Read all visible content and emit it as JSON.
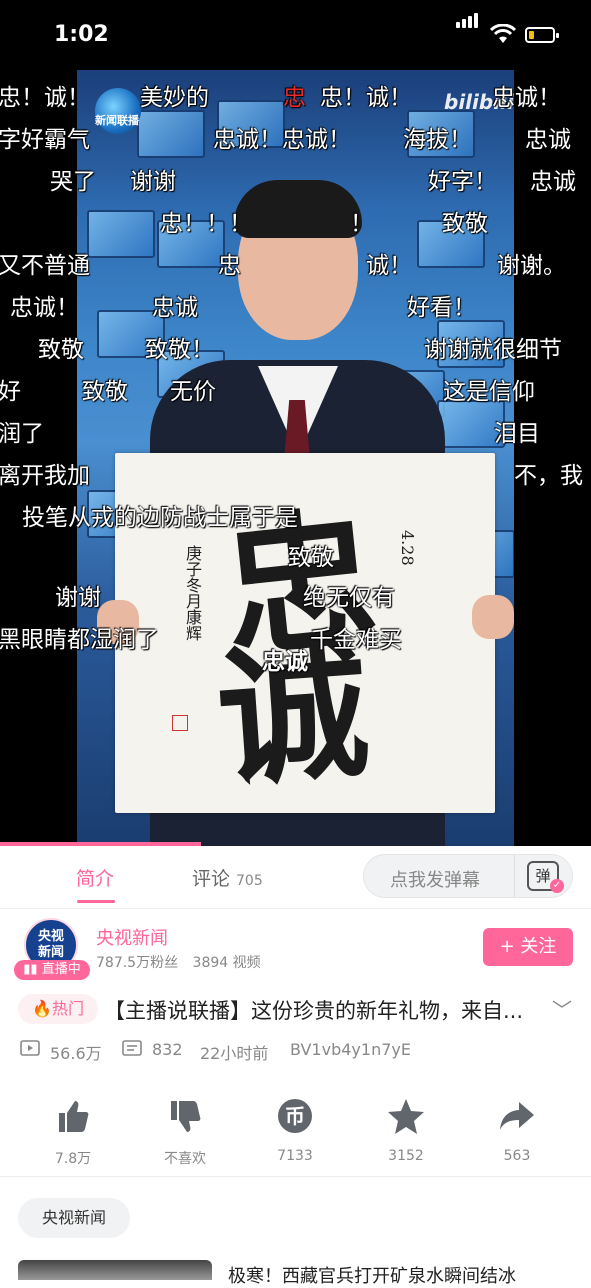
{
  "status_bar": {
    "time": "1:02"
  },
  "video": {
    "channel_logo_text": "新闻联播",
    "watermark": "bilibili",
    "calligraphy": {
      "char1": "忠",
      "char2": "诚",
      "left_inscription": "庚子冬月康辉",
      "right_inscription": "4.28"
    },
    "danmaku": [
      "忠！诚！",
      "美妙的",
      "忠",
      "忠！诚！",
      "忠诚！",
      "字好霸气",
      "忠诚！忠诚！",
      "海拔！",
      "忠诚",
      "哭了",
      "谢谢",
      "好字！",
      "忠诚",
      "忠！！！",
      "！",
      "致敬",
      "又不普通",
      "忠",
      "诚！",
      "谢谢。",
      "忠诚！",
      "忠诚",
      "好看！",
      "致敬",
      "致敬！",
      "谢谢就很细节",
      "好",
      "致敬",
      "无价",
      "这是信仰",
      "润了",
      "泪目",
      "离开我加",
      "不，我",
      "投笔从戎的边防战士属于是",
      "致敬",
      "谢谢",
      "绝无仅有",
      "黑眼睛都湿润了",
      "千金难买",
      "忠诚"
    ],
    "progress": 0.34
  },
  "tabs": {
    "intro_label": "简介",
    "comments_label": "评论",
    "comments_count": "705",
    "danmaku_placeholder": "点我发弹幕",
    "danmaku_toggle_label": "弹"
  },
  "author": {
    "avatar_text_1": "央视",
    "avatar_text_2": "新闻",
    "live_label": "直播中",
    "name": "央视新闻",
    "fans": "787.5万粉丝",
    "videos": "3894 视频",
    "follow_label": "+ 关注"
  },
  "video_info": {
    "hot_tag": "热门",
    "title": "【主播说联播】这份珍贵的新年礼物，来自...",
    "views": "56.6万",
    "danmaku_count": "832",
    "time_ago": "22小时前",
    "bvid": "BV1vb4y1n7yE"
  },
  "actions": {
    "like": "7.8万",
    "dislike": "不喜欢",
    "coin": "7133",
    "favorite": "3152",
    "share": "563"
  },
  "related": {
    "up_tag": "央视新闻",
    "rec_title": "极寒！西藏官兵打开矿泉水瞬间结冰"
  },
  "colors": {
    "accent": "#ff6699",
    "text_muted": "#888888"
  }
}
